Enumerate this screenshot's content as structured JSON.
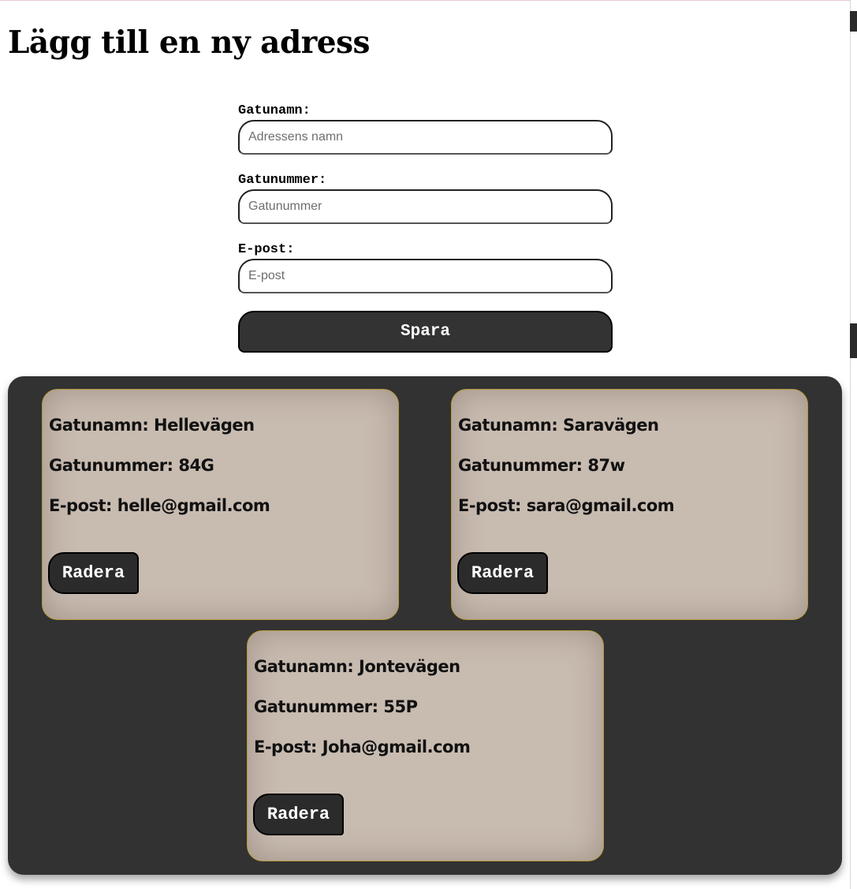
{
  "page": {
    "title": "Lägg till en ny adress"
  },
  "form": {
    "street_name_label": "Gatunamn:",
    "street_name_placeholder": "Adressens namn",
    "street_number_label": "Gatunummer:",
    "street_number_placeholder": "Gatunummer",
    "email_label": "E-post:",
    "email_placeholder": "E-post",
    "save_label": "Spara"
  },
  "addresses": [
    {
      "street_name": "Gatunamn: Hellevägen",
      "street_number": "Gatunummer: 84G",
      "email": "E-post: helle@gmail.com",
      "delete_label": "Radera"
    },
    {
      "street_name": "Gatunamn: Saravägen",
      "street_number": "Gatunummer: 87w",
      "email": "E-post: sara@gmail.com",
      "delete_label": "Radera"
    },
    {
      "street_name": "Gatunamn: Jontevägen",
      "street_number": "Gatunummer: 55P",
      "email": "E-post: Joha@gmail.com",
      "delete_label": "Radera"
    }
  ],
  "colors": {
    "panel_background": "#323232",
    "card_background": "#c8bbb0",
    "card_border": "#b59a3a",
    "button_background": "#333333",
    "button_text": "#ffffff"
  }
}
